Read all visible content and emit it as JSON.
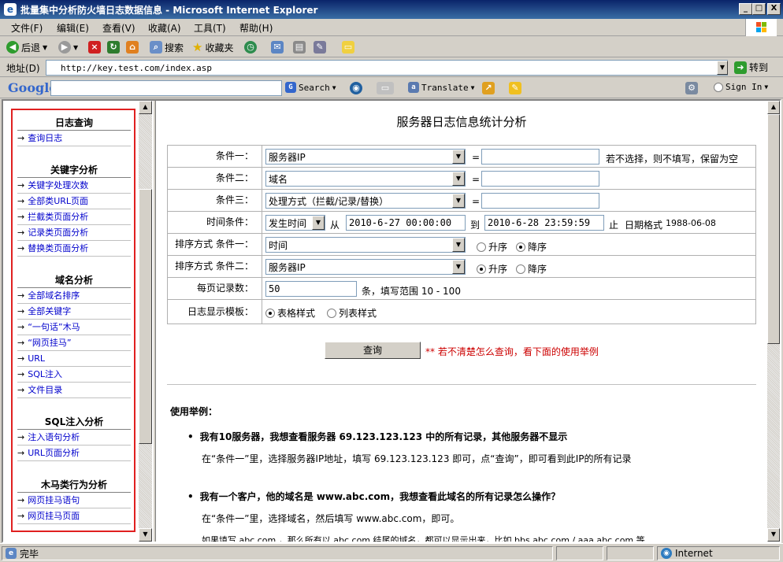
{
  "window": {
    "title": "批量集中分析防火墙日志数据信息 - Microsoft Internet Explorer",
    "controls": {
      "min": "_",
      "max": "□",
      "close": "X"
    }
  },
  "menubar": {
    "items": [
      "文件(F)",
      "编辑(E)",
      "查看(V)",
      "收藏(A)",
      "工具(T)",
      "帮助(H)"
    ]
  },
  "toolbar": {
    "back": "后退",
    "search": "搜索",
    "favorites": "收藏夹"
  },
  "address": {
    "label": "地址(D)",
    "url": "http://key.test.com/index.asp",
    "go": "转到"
  },
  "googlebar": {
    "logo": "Google",
    "search": "Search",
    "translate": "Translate",
    "signin": "Sign In"
  },
  "nav": {
    "arrow": "→",
    "sections": [
      {
        "title": "日志查询",
        "items": [
          "查询日志"
        ]
      },
      {
        "title": "关键字分析",
        "items": [
          "关键字处理次数",
          "全部类URL页面",
          "拦截类页面分析",
          "记录类页面分析",
          "替换类页面分析"
        ]
      },
      {
        "title": "域名分析",
        "items": [
          "全部域名排序",
          "全部关键字",
          "“一句话”木马",
          "“网页挂马”",
          "URL",
          "SQL注入",
          "文件目录"
        ]
      },
      {
        "title": "SQL注入分析",
        "items": [
          "注入语句分析",
          "URL页面分析"
        ]
      },
      {
        "title": "木马类行为分析",
        "items": [
          "网页挂马语句",
          "网页挂马页面"
        ]
      }
    ]
  },
  "main": {
    "title": "服务器日志信息统计分析",
    "form": {
      "cond1": {
        "label": "条件一：",
        "select": "服务器IP",
        "eq": "=",
        "value": "",
        "hint": "若不选择，则不填写，保留为空"
      },
      "cond2": {
        "label": "条件二：",
        "select": "域名",
        "eq": "=",
        "value": ""
      },
      "cond3": {
        "label": "条件三：",
        "select": "处理方式（拦截/记录/替换）",
        "eq": "=",
        "value": ""
      },
      "time": {
        "label": "时间条件：",
        "select": "发生时间",
        "from": "从",
        "start": "2010-6-27 00:00:00",
        "to": "到",
        "end": "2010-6-28 23:59:59",
        "stop": "止",
        "format": "日期格式",
        "format_example": "1988-06-08"
      },
      "sort1": {
        "label": "排序方式 条件一：",
        "select": "时间",
        "asc": "升序",
        "desc": "降序",
        "selected": "desc"
      },
      "sort2": {
        "label": "排序方式 条件二：",
        "select": "服务器IP",
        "asc": "升序",
        "desc": "降序",
        "selected": "asc"
      },
      "perpage": {
        "label": "每页记录数：",
        "value": "50",
        "hint": "条，填写范围 10 - 100"
      },
      "template": {
        "label": "日志显示模板：",
        "table": "表格样式",
        "list": "列表样式",
        "selected": "table"
      }
    },
    "query_button": "查询",
    "query_note": "** 若不清楚怎么查询，看下面的使用举例",
    "usage": {
      "title": "使用举例：",
      "examples": [
        {
          "q": "我有10服务器，我想查看服务器 69.123.123.123 中的所有记录，其他服务器不显示",
          "a": "在“条件一”里，选择服务器IP地址，填写 69.123.123.123 即可，点“查询”，即可看到此IP的所有记录"
        },
        {
          "q": "我有一个客户，他的域名是 www.abc.com，我想查看此域名的所有记录怎么操作？",
          "a": "在“条件一”里，选择域名，然后填写 www.abc.com，即可。",
          "a2": "如果填写 abc.com ，那么所有以 abc.com 结尾的域名，都可以显示出来，比如 bbs.abc.com / aaa.abc.com 等"
        }
      ]
    }
  },
  "status": {
    "text": "完毕",
    "zone": "Internet"
  }
}
